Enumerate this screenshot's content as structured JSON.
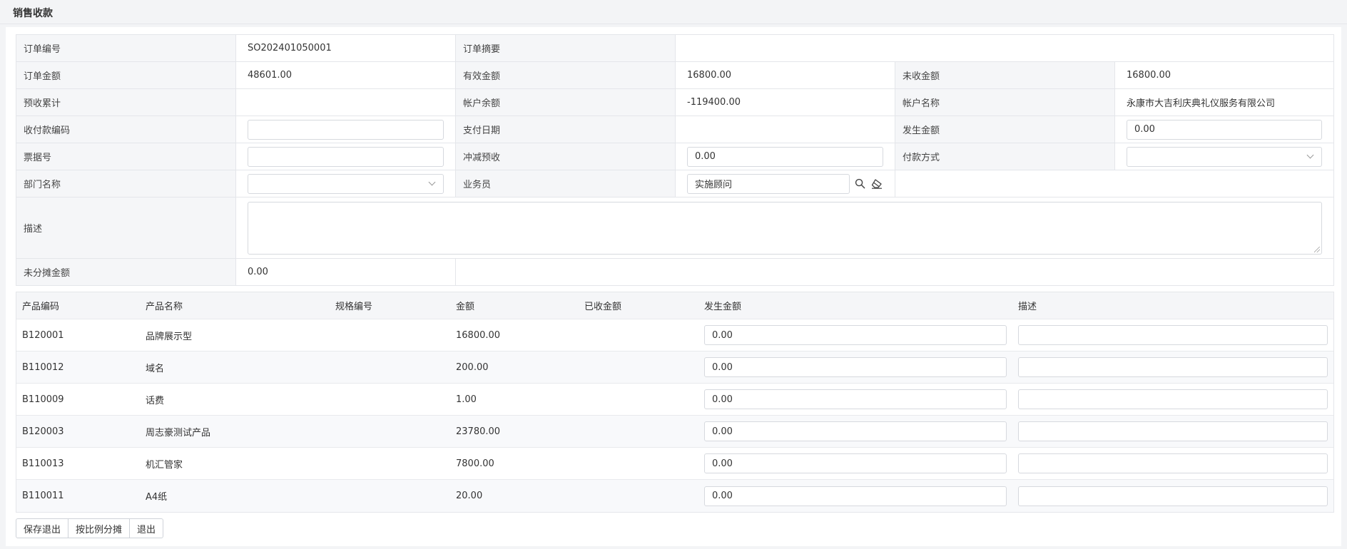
{
  "page": {
    "title": "销售收款"
  },
  "form": {
    "order_no_label": "订单编号",
    "order_no": "SO202401050001",
    "order_summary_label": "订单摘要",
    "order_summary": "",
    "order_amount_label": "订单金额",
    "order_amount": "48601.00",
    "effective_amount_label": "有效金额",
    "effective_amount": "16800.00",
    "uncollected_label": "未收金额",
    "uncollected": "16800.00",
    "prepaid_total_label": "预收累计",
    "prepaid_total": "",
    "account_balance_label": "帐户余额",
    "account_balance": "-119400.00",
    "account_name_label": "帐户名称",
    "account_name": "永康市大吉利庆典礼仪服务有限公司",
    "payment_code_label": "收付款编码",
    "payment_code": "",
    "pay_date_label": "支付日期",
    "pay_date": "",
    "occur_amount_label": "发生金额",
    "occur_amount": "0.00",
    "receipt_no_label": "票据号",
    "receipt_no": "",
    "offset_prepaid_label": "冲减预收",
    "offset_prepaid": "0.00",
    "pay_method_label": "付款方式",
    "pay_method": "",
    "dept_label": "部门名称",
    "dept": "",
    "salesman_label": "业务员",
    "salesman": "实施顾问",
    "description_label": "描述",
    "description": "",
    "unallocated_label": "未分摊金额",
    "unallocated": "0.00"
  },
  "table": {
    "headers": [
      "产品编码",
      "产品名称",
      "规格编号",
      "金额",
      "已收金额",
      "发生金额",
      "描述"
    ],
    "rows": [
      {
        "code": "B120001",
        "name": "品牌展示型",
        "spec": "",
        "amount": "16800.00",
        "received": "",
        "occur": "0.00",
        "desc": ""
      },
      {
        "code": "B110012",
        "name": "域名",
        "spec": "",
        "amount": "200.00",
        "received": "",
        "occur": "0.00",
        "desc": ""
      },
      {
        "code": "B110009",
        "name": "话费",
        "spec": "",
        "amount": "1.00",
        "received": "",
        "occur": "0.00",
        "desc": ""
      },
      {
        "code": "B120003",
        "name": "周志豪测试产品",
        "spec": "",
        "amount": "23780.00",
        "received": "",
        "occur": "0.00",
        "desc": ""
      },
      {
        "code": "B110013",
        "name": "机汇管家",
        "spec": "",
        "amount": "7800.00",
        "received": "",
        "occur": "0.00",
        "desc": ""
      },
      {
        "code": "B110011",
        "name": "A4纸",
        "spec": "",
        "amount": "20.00",
        "received": "",
        "occur": "0.00",
        "desc": ""
      }
    ]
  },
  "buttons": {
    "save_exit": "保存退出",
    "allocate": "按比例分摊",
    "exit": "退出"
  },
  "icons": {
    "search": "search-icon",
    "clear": "eraser-icon",
    "dropdown": "chevron-down-icon"
  }
}
